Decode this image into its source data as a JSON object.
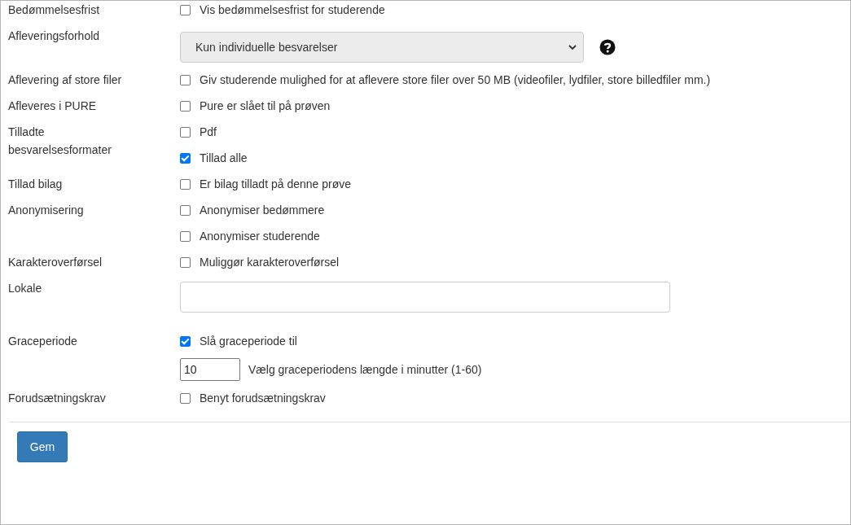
{
  "rows": [
    {
      "label": "Bedømmelsesfrist",
      "items": [
        {
          "kind": "checkbox",
          "text": "Vis bedømmelsesfrist for studerende",
          "checked": false
        }
      ]
    },
    {
      "label": "Afleveringsforhold",
      "items": [
        {
          "kind": "select",
          "value": "Kun individuelle besvarelser",
          "help": true
        }
      ]
    },
    {
      "label": "Aflevering af store filer",
      "items": [
        {
          "kind": "checkbox",
          "text": "Giv studerende mulighed for at aflevere store filer over 50 MB (videofiler, lydfiler, store billedfiler mm.)",
          "checked": false
        }
      ]
    },
    {
      "label": "Afleveres i PURE",
      "items": [
        {
          "kind": "checkbox",
          "text": "Pure er slået til på prøven",
          "checked": false
        }
      ]
    },
    {
      "label": "Tilladte besvarelsesformater",
      "items": [
        {
          "kind": "checkbox",
          "text": "Pdf",
          "checked": false
        },
        {
          "kind": "checkbox",
          "text": "Tillad alle",
          "checked": true
        }
      ]
    },
    {
      "label": "Tillad bilag",
      "items": [
        {
          "kind": "checkbox",
          "text": "Er bilag tilladt på denne prøve",
          "checked": false
        }
      ]
    },
    {
      "label": "Anonymisering",
      "items": [
        {
          "kind": "checkbox",
          "text": "Anonymiser bedømmere",
          "checked": false
        },
        {
          "kind": "checkbox",
          "text": "Anonymiser studerende",
          "checked": false
        }
      ]
    },
    {
      "label": "Karakteroverførsel",
      "items": [
        {
          "kind": "checkbox",
          "text": "Muliggør karakteroverførsel",
          "checked": false
        }
      ]
    },
    {
      "label": "Lokale",
      "items": [
        {
          "kind": "text"
        }
      ]
    },
    {
      "label": "Graceperiode",
      "items": [
        {
          "kind": "checkbox",
          "text": "Slå graceperiode til",
          "checked": true
        },
        {
          "kind": "number",
          "value": "10",
          "text": "Vælg graceperiodens længde i minutter (1-60)"
        }
      ]
    },
    {
      "label": "Forudsætningskrav",
      "items": [
        {
          "kind": "checkbox",
          "text": "Benyt forudsætningskrav",
          "checked": false
        }
      ]
    }
  ],
  "save_button": "Gem"
}
